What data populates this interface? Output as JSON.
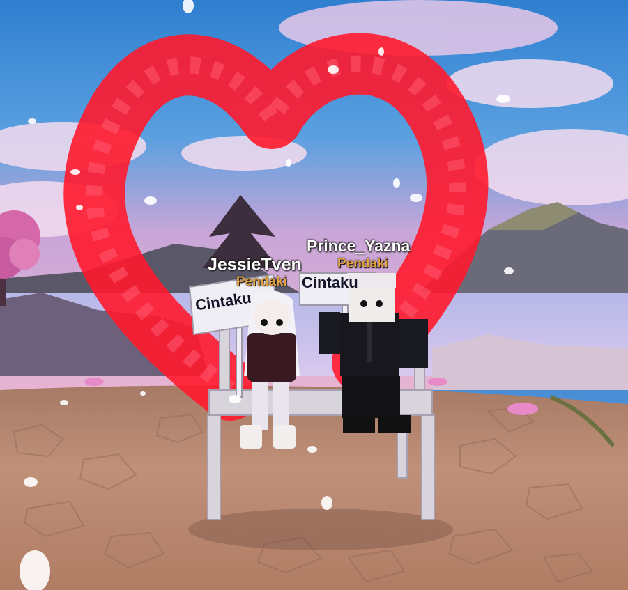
{
  "players": [
    {
      "name": "JessieTven",
      "title": "Pendaki",
      "sign": "Cintaku"
    },
    {
      "name": "Prince_Yazna",
      "title": "Pendaki",
      "sign": "Cintaku"
    }
  ],
  "colors": {
    "heart": "#ff1a2e",
    "sky_top": "#2f7fd0",
    "ground": "#b98a6e",
    "name_text": "#ffffff",
    "title_text": "#e0a040"
  }
}
